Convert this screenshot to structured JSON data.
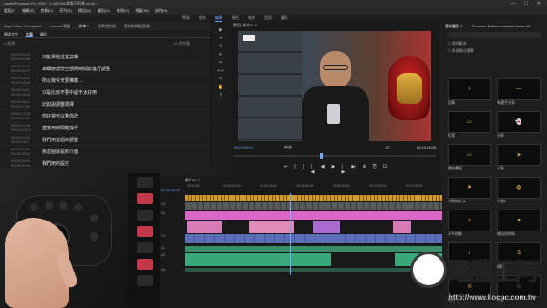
{
  "window": {
    "title": "Adobe Premiere Pro 2022 - C:\\MEDIA\\電腦王阿達.prproj *",
    "controls": [
      "—",
      "▢",
      "✕"
    ]
  },
  "menu": [
    "檔案(F)",
    "編輯(E)",
    "剪輯(C)",
    "序列(S)",
    "標記(M)",
    "圖形(G)",
    "檢視(V)",
    "視窗(W)",
    "說明(H)"
  ],
  "workspaces": [
    "學習",
    "組合",
    "編輯",
    "顏色",
    "效果",
    "音訊",
    "圖形"
  ],
  "workspace_active": 2,
  "text_panel": {
    "tabs": [
      "Align Editor Workspace",
      "Lumetri 範圍",
      "文字 ≡",
      "效果控制項",
      "音訊剪輯混音器"
    ],
    "subtabs": [
      "轉錄文字",
      "字幕",
      "圖形"
    ],
    "toolbar": "Q 搜尋",
    "count": "21 個字幕",
    "rows": [
      {
        "tc": "00:00:04:02\n00:00:05:28",
        "text": "只能單點位置剪輯"
      },
      {
        "tc": "00:00:06:07\n00:00:09:20",
        "text": "來細節部份全部照時間去進行調整"
      },
      {
        "tc": "00:00:10:12\n00:00:12:18",
        "text": "所以我今天要推薦…"
      },
      {
        "tc": "00:00:13:01\n00:00:14:15",
        "text": "只是比較不要中處不太好用"
      },
      {
        "tc": "00:00:15:11\n00:00:17:06",
        "text": "比如說調整選擇"
      },
      {
        "tc": "00:00:17:28\n00:00:20:03",
        "text": "你好常可以幫你改"
      },
      {
        "tc": "00:00:21:00\n00:00:23:14",
        "text": "直接用時間軸操作"
      },
      {
        "tc": "00:00:24:01\n00:00:26:11",
        "text": "我們用這個來調整"
      },
      {
        "tc": "00:00:26:20\n00:00:28:22",
        "text": "那這個就是新介面"
      },
      {
        "tc": "00:00:29:05\n00:00:30:19",
        "text": "我們用的設定"
      }
    ]
  },
  "monitor": {
    "title": "節目: 影片01 ≡",
    "timecode_current": "00:01:09:27",
    "fit": "符合",
    "resolution": "1/2",
    "timecode_end": "00:13:24:05",
    "controls": [
      "⇤",
      "{",
      "}",
      "|◀",
      "◀|",
      "▶",
      "|▶",
      "▶|",
      "⊕",
      "⎘",
      "⊡"
    ]
  },
  "tools": [
    "▶",
    "⇥",
    "✣",
    "⊳",
    "✂",
    "⟷",
    "✎",
    "✋",
    "T"
  ],
  "effects_panel": {
    "tabs": [
      "基本圖形 ≡",
      "Premium Builder Animated Icons Kit"
    ],
    "options": [
      "☐ 我的範本",
      "☐ 多個格式選單"
    ],
    "items": [
      {
        "label": "記事",
        "glyph": "✧"
      },
      {
        "label": "有選手分享",
        "glyph": "—"
      },
      {
        "label": "紅燈",
        "glyph": "▭"
      },
      {
        "label": "分享",
        "glyph": "👻"
      },
      {
        "label": "總結畫面",
        "glyph": "▭"
      },
      {
        "label": "小點",
        "glyph": "➤"
      },
      {
        "label": "小總結文字",
        "glyph": "⚑"
      },
      {
        "label": "小點2",
        "glyph": "❂"
      },
      {
        "label": "水平移動",
        "glyph": "✈"
      },
      {
        "label": "標記說明頁",
        "glyph": "●"
      },
      {
        "label": "符號",
        "glyph": "ɪ"
      },
      {
        "label": "標題",
        "glyph": "$"
      },
      {
        "label": "地點",
        "glyph": "◎"
      },
      {
        "label": "大便",
        "glyph": "♨"
      }
    ]
  },
  "timeline": {
    "tab": "影片01 ≡",
    "timecode": "00:01:09:27",
    "ruler": [
      "00:00:00",
      "00:02:00:00",
      "00:04:00:00",
      "00:06:00:00",
      "00:08:00:00",
      "00:10:00:00",
      "00:12:00:00"
    ],
    "tracks": [
      "V3",
      "V2",
      "V1",
      "A1",
      "A2",
      "A3"
    ]
  },
  "watermark": {
    "name": "電腦王阿達",
    "url": "http://www.kocpc.com.tw"
  }
}
